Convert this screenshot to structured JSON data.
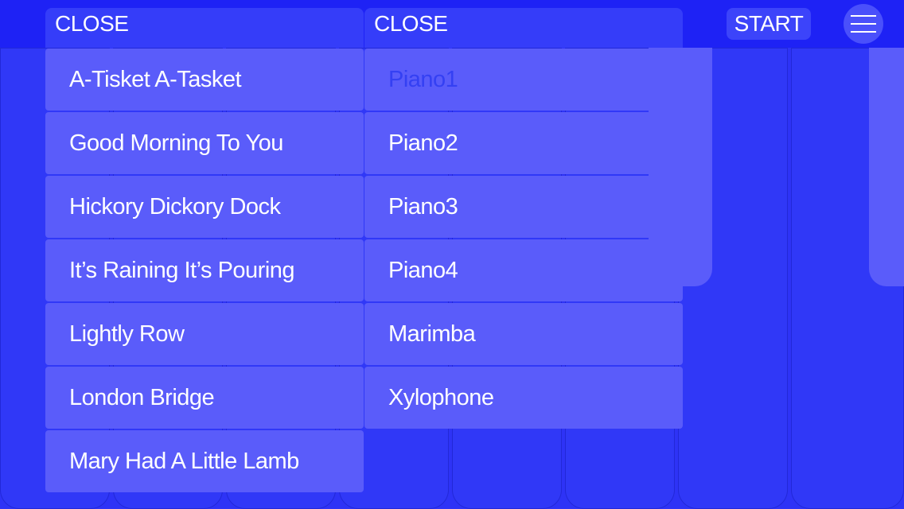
{
  "header": {
    "left_close": "CLOSE",
    "right_close": "CLOSE",
    "start": "START",
    "menu_icon": "hamburger-menu-icon"
  },
  "songs": [
    "A-Tisket A-Tasket",
    "Good Morning To You",
    "Hickory Dickory Dock",
    "It’s Raining It’s Pouring",
    "Lightly Row",
    "London Bridge",
    "Mary Had A Little Lamb"
  ],
  "instruments": [
    "Piano1",
    "Piano2",
    "Piano3",
    "Piano4",
    "Marimba",
    "Xylophone"
  ],
  "selected_instrument": "Piano1",
  "colors": {
    "background": "#2e33f6",
    "topbar": "#1e22f5",
    "list_item": "#5a5cfa",
    "selected_text": "#3440f3",
    "text": "#ffffff"
  }
}
